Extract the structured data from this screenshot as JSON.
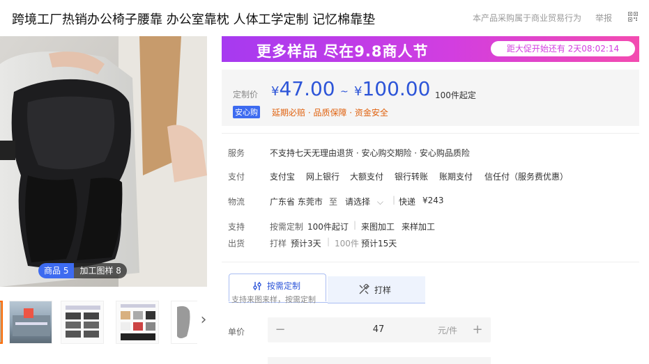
{
  "header": {
    "title": "跨境工厂热销办公椅子腰靠 办公室靠枕 人体工学定制 记忆棉靠垫",
    "note": "本产品采购属于商业贸易行为",
    "report": "举报",
    "qr_icon": "qrcode-icon"
  },
  "gallery": {
    "badge_products": "商品 5",
    "badge_samples": "加工图样 8",
    "next_icon": "chevron-right-icon"
  },
  "promo": {
    "text": "更多样品 尽在9.8商人节",
    "countdown": "距大促开始还有 2天08:02:14",
    "gradient": [
      "#a63af0",
      "#d23ee0",
      "#f34bb0"
    ]
  },
  "price": {
    "label": "定制价",
    "currency": "¥",
    "low": "47.00",
    "tilde": "~",
    "high": "100.00",
    "moq": "100件起定",
    "secure_badge": "安心购",
    "secure_text": "延期必赔 · 品质保障 · 资金安全",
    "accent": "#2d55d8"
  },
  "info": {
    "service_label": "服务",
    "service_value": "不支持七天无理由退货 · 安心购交期险 · 安心购品质险",
    "pay_label": "支付",
    "pay_methods": [
      "支付宝",
      "网上银行",
      "大额支付",
      "银行转账",
      "账期支付",
      "信任付（服务费优惠）"
    ],
    "logistics_label": "物流",
    "origin": "广东省 东莞市",
    "to": "至",
    "dest": "请选择",
    "express": "快递",
    "fee": "¥243",
    "support_label": "支持",
    "ship_label": "出货",
    "support_items": [
      "按需定制",
      "100件起订",
      "来图加工",
      "来样加工"
    ],
    "ship_sample": "打样",
    "ship_sample_days": "预计3天",
    "ship_bulk": "100件",
    "ship_bulk_days": "预计15天"
  },
  "tabs": {
    "tab1_title": "按需定制",
    "tab1_sub": "支持来图来样，按需定制",
    "tab2_title": "打样"
  },
  "order": {
    "unit_label": "单价",
    "minus": "−",
    "qty": "47",
    "unit": "元/件",
    "plus": "+"
  }
}
